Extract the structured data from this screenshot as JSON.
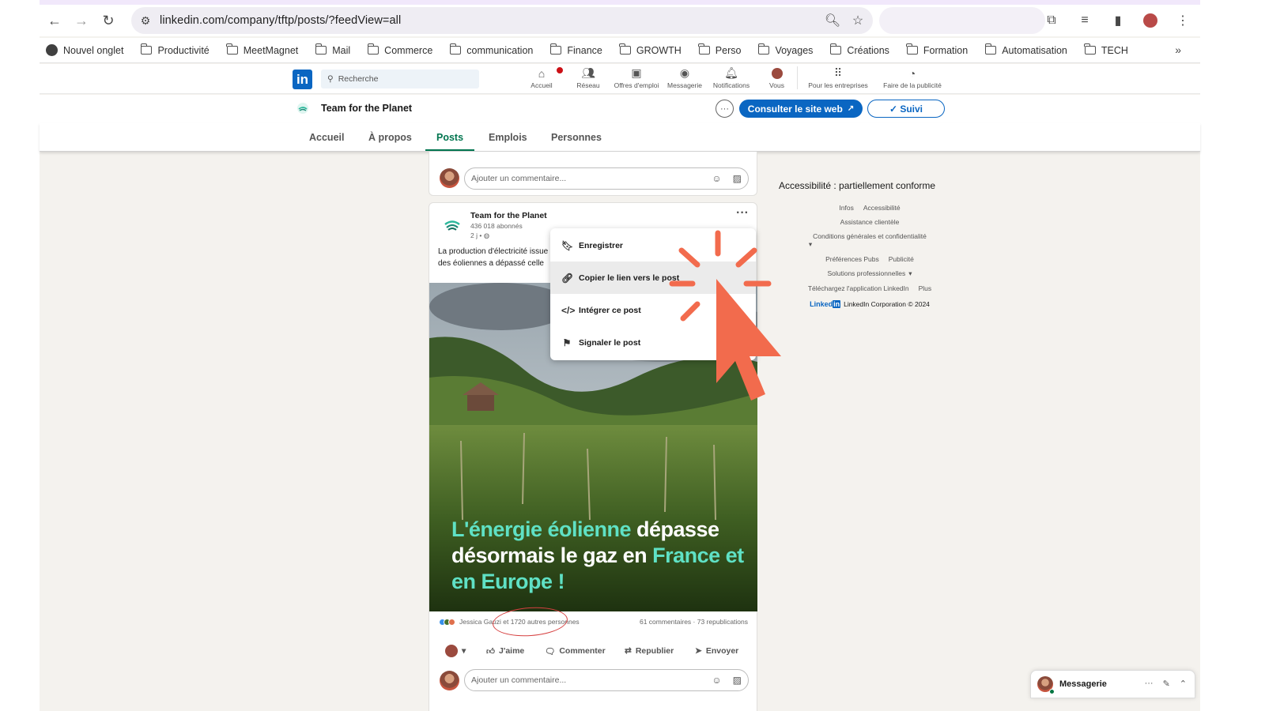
{
  "browser": {
    "url": "linkedin.com/company/tftp/posts/?feedView=all",
    "bookmarks": [
      "Nouvel onglet",
      "Productivité",
      "MeetMagnet",
      "Mail",
      "Commerce",
      "communication",
      "Finance",
      "GROWTH",
      "Perso",
      "Voyages",
      "Créations",
      "Formation",
      "Automatisation",
      "TECH"
    ]
  },
  "linkedin": {
    "logo": "in",
    "search_placeholder": "Recherche",
    "nav": [
      "Accueil",
      "Réseau",
      "Offres d'emploi",
      "Messagerie",
      "Notifications",
      "Vous",
      "Pour les entreprises",
      "Faire de la publicité"
    ]
  },
  "company": {
    "name": "Team for the Planet",
    "more": "···",
    "visit_button": "Consulter le site web",
    "follow_button": "✓ Suivi",
    "tabs": [
      "Accueil",
      "À propos",
      "Posts",
      "Emplois",
      "Personnes"
    ],
    "active_tab": "Posts"
  },
  "feed": {
    "comment_placeholder": "Ajouter un commentaire...",
    "post": {
      "author": "Team for the Planet",
      "followers": "436 018 abonnés",
      "time": "2 j •",
      "text": "La production d'électricité issue des éoliennes a dépassé celle des centrales à gaz en Europe 😍😍",
      "headline_parts": [
        {
          "text": "L'énergie éolienne",
          "accent": true
        },
        {
          "text": " dépasse désormais le gaz en ",
          "accent": false
        },
        {
          "text": "France et en Europe !",
          "accent": true
        }
      ],
      "reactions": "Jessica Gauzi et 1720 autres personnes",
      "stats": "61 commentaires · 73 republications",
      "actions": [
        "J'aime",
        "Commenter",
        "Republier",
        "Envoyer"
      ]
    }
  },
  "menu": {
    "items": [
      {
        "label": "Enregistrer",
        "icon": "bookmark-icon"
      },
      {
        "label": "Copier le lien vers le post",
        "icon": "link-icon"
      },
      {
        "label": "Intégrer ce post",
        "icon": "code-icon"
      },
      {
        "label": "Signaler le post",
        "icon": "flag-icon"
      }
    ],
    "highlighted": "Copier le lien vers le post"
  },
  "right_rail": {
    "accessibility": "Accessibilité : partiellement conforme",
    "links_row1": [
      "Infos",
      "Accessibilité"
    ],
    "links_row2": [
      "Assistance clientèle"
    ],
    "links_row3": [
      "Conditions générales et confidentialité"
    ],
    "links_row4": [
      "Préférences Pubs",
      "Publicité"
    ],
    "links_row5": [
      "Solutions professionnelles"
    ],
    "links_row6": [
      "Téléchargez l'application LinkedIn",
      "Plus"
    ],
    "corp_logo_text": "Linked",
    "corp_logo_badge": "in",
    "corp": "LinkedIn Corporation © 2024"
  },
  "messaging": {
    "label": "Messagerie"
  },
  "colors": {
    "linkedin_blue": "#0a66c2",
    "active_green": "#01754f",
    "cursor_orange": "#f26b4d",
    "headline_accent": "#5fe1c5"
  }
}
